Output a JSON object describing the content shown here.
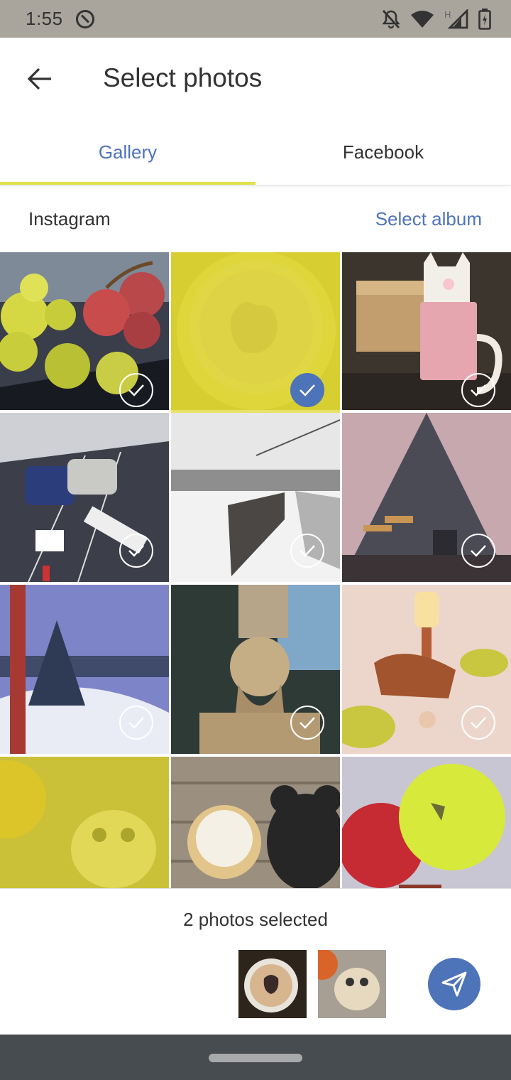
{
  "status_bar": {
    "time": "1:55"
  },
  "header": {
    "title": "Select photos"
  },
  "tabs": [
    {
      "label": "Gallery",
      "active": true
    },
    {
      "label": "Facebook",
      "active": false
    }
  ],
  "album": {
    "name": "Instagram",
    "select_label": "Select album"
  },
  "photos": [
    {
      "subject": "grapes",
      "selected": false
    },
    {
      "subject": "cat-cake",
      "selected": true
    },
    {
      "subject": "paper-cat",
      "selected": false
    },
    {
      "subject": "slot-cars",
      "selected": false
    },
    {
      "subject": "snowy-ski-lift",
      "selected": false
    },
    {
      "subject": "cone-tent",
      "selected": false
    },
    {
      "subject": "snowy-trees",
      "selected": false
    },
    {
      "subject": "wood-carving",
      "selected": false
    },
    {
      "subject": "candle-cake",
      "selected": false
    },
    {
      "subject": "panda-cookie",
      "selected": true
    },
    {
      "subject": "bear-cookies",
      "selected": false
    },
    {
      "subject": "balloons",
      "selected": false
    }
  ],
  "footer": {
    "selected_text": "2 photos selected"
  },
  "colors": {
    "accent": "#4d73b8",
    "tab_indicator": "#e0e24a",
    "status_bar": "#a9a59d",
    "nav_bar": "#474c51"
  }
}
